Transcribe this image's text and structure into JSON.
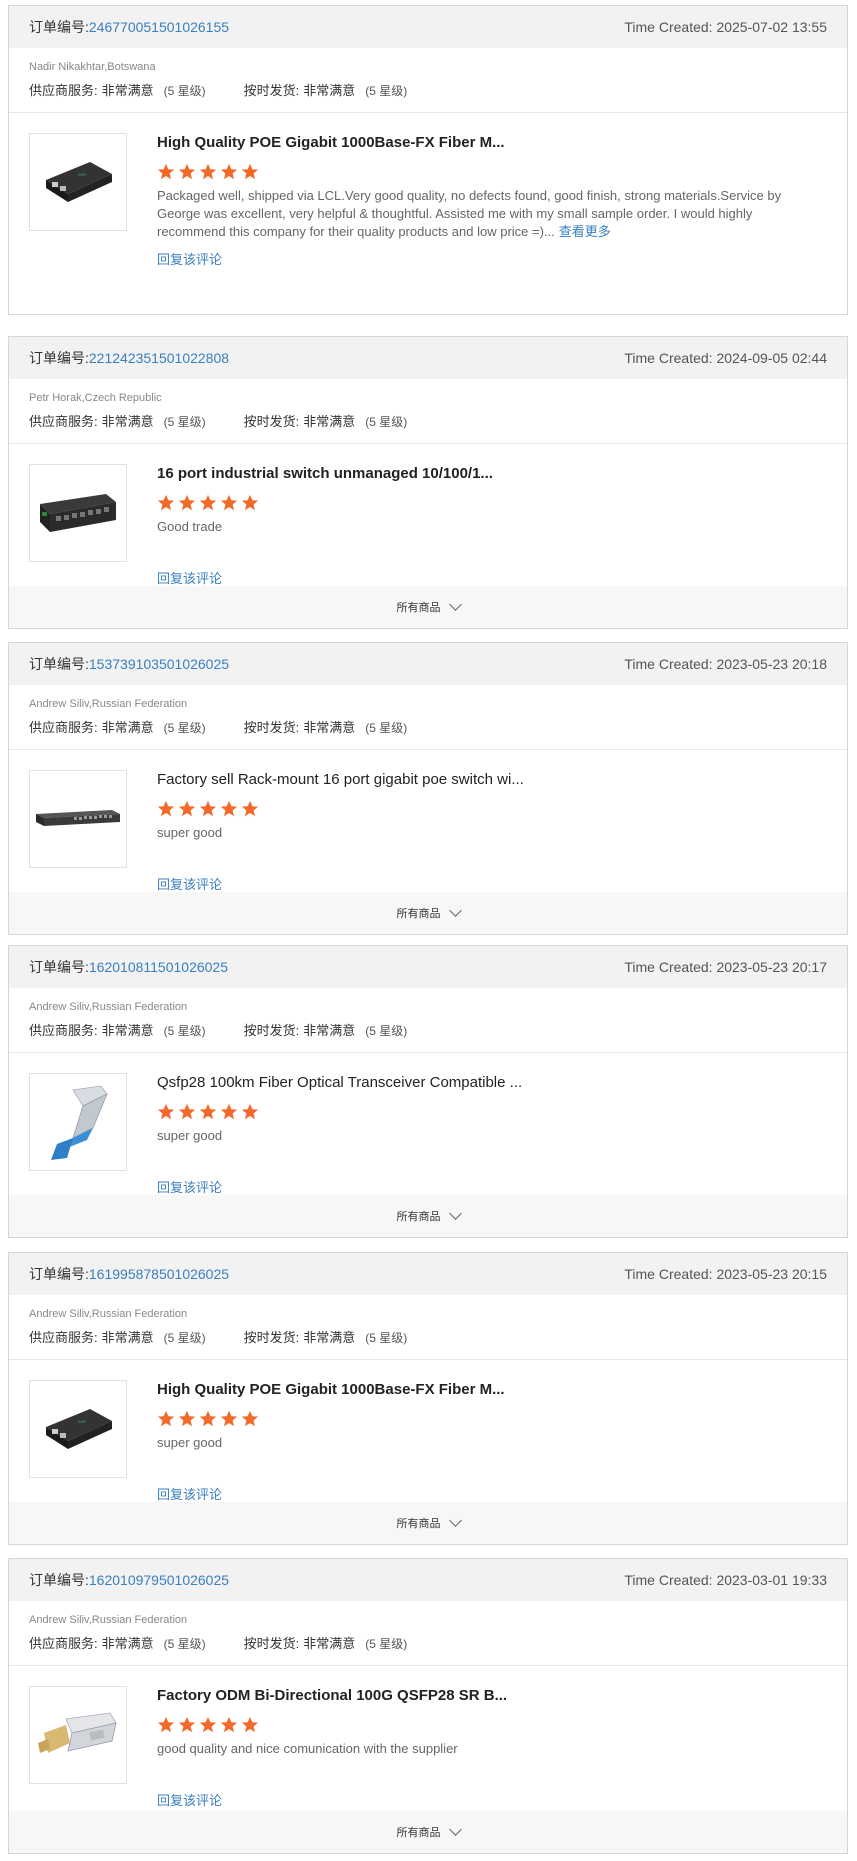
{
  "labels": {
    "order_no_prefix": "订单编号:",
    "time_created_prefix": "Time Created:",
    "supplier_service": "供应商服务:",
    "on_time_delivery": "按时发货:",
    "reply": "回复该评论",
    "all_products": "所有商品",
    "see_more": "查看更多"
  },
  "colors": {
    "link": "#3a7fbf",
    "star": "#f2692a",
    "header_bg": "#f2f2f2"
  },
  "orders": [
    {
      "order_no": "246770051501026155",
      "time_created": "2025-07-02 13:55",
      "buyer": "Nadir Nikakhtar,Botswana",
      "supplier_service_value": "非常满意",
      "supplier_service_level": "(5 星级)",
      "delivery_value": "非常满意",
      "delivery_level": "(5 星级)",
      "product_title": "High Quality POE Gigabit 1000Base-FX Fiber M...",
      "rating": 5,
      "review": "Packaged well, shipped via LCL.Very good quality, no defects found, good finish, strong materials.Service by George was excellent, very helpful & thoughtful. Assisted me with my small sample order. I would highly recommend this company for their quality products and low price =)...",
      "thumb_icon": "media-converter-icon"
    },
    {
      "order_no": "221242351501022808",
      "time_created": "2024-09-05 02:44",
      "buyer": "Petr Horak,Czech Republic",
      "supplier_service_value": "非常满意",
      "supplier_service_level": "(5 星级)",
      "delivery_value": "非常满意",
      "delivery_level": "(5 星级)",
      "product_title": "16 port industrial switch unmanaged 10/100/1...",
      "rating": 5,
      "review": "Good trade",
      "thumb_icon": "industrial-switch-icon"
    },
    {
      "order_no": "153739103501026025",
      "time_created": "2023-05-23 20:18",
      "buyer": "Andrew Siliv,Russian Federation",
      "supplier_service_value": "非常满意",
      "supplier_service_level": "(5 星级)",
      "delivery_value": "非常满意",
      "delivery_level": "(5 星级)",
      "product_title": "Factory sell Rack-mount 16 port gigabit poe switch wi...",
      "rating": 5,
      "review": "super good",
      "thumb_icon": "rack-switch-icon"
    },
    {
      "order_no": "162010811501026025",
      "time_created": "2023-05-23 20:17",
      "buyer": "Andrew Siliv,Russian Federation",
      "supplier_service_value": "非常满意",
      "supplier_service_level": "(5 星级)",
      "delivery_value": "非常满意",
      "delivery_level": "(5 星级)",
      "product_title": "Qsfp28 100km Fiber Optical Transceiver Compatible ...",
      "rating": 5,
      "review": "super good",
      "thumb_icon": "transceiver-blue-icon"
    },
    {
      "order_no": "161995878501026025",
      "time_created": "2023-05-23 20:15",
      "buyer": "Andrew Siliv,Russian Federation",
      "supplier_service_value": "非常满意",
      "supplier_service_level": "(5 星级)",
      "delivery_value": "非常满意",
      "delivery_level": "(5 星级)",
      "product_title": "High Quality POE Gigabit 1000Base-FX Fiber M...",
      "rating": 5,
      "review": "super good",
      "thumb_icon": "media-converter-icon"
    },
    {
      "order_no": "162010979501026025",
      "time_created": "2023-03-01 19:33",
      "buyer": "Andrew Siliv,Russian Federation",
      "supplier_service_value": "非常满意",
      "supplier_service_level": "(5 星级)",
      "delivery_value": "非常满意",
      "delivery_level": "(5 星级)",
      "product_title": "Factory ODM Bi-Directional 100G QSFP28 SR B...",
      "rating": 5,
      "review": "good quality and nice comunication with the supplier",
      "thumb_icon": "transceiver-gold-icon"
    }
  ]
}
